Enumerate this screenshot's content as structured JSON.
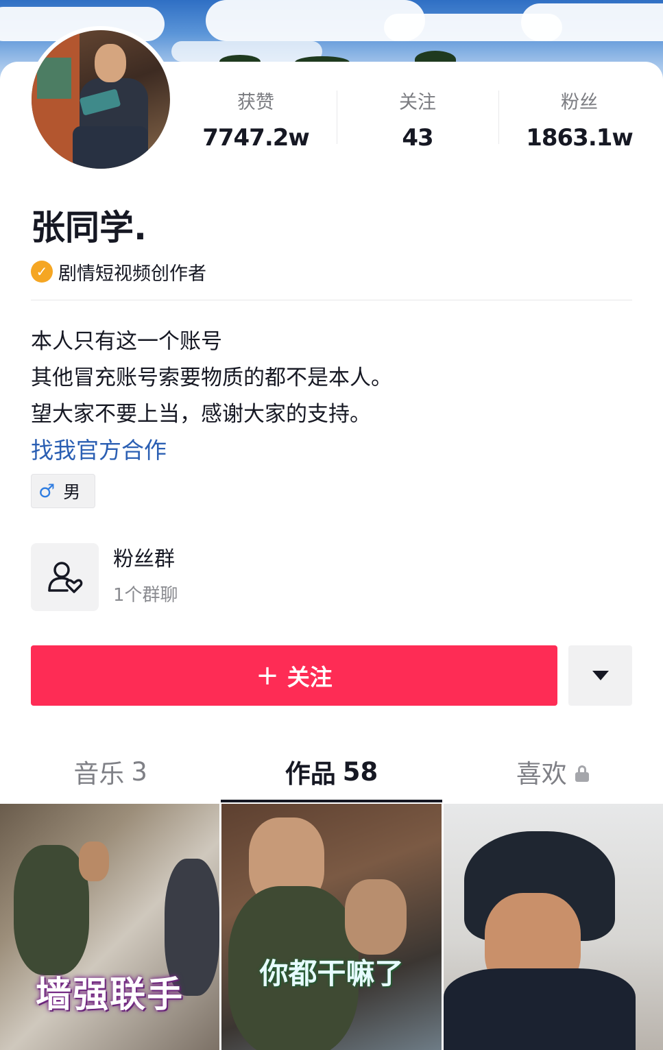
{
  "profile": {
    "name": "张同学.",
    "verification": "剧情短视频创作者",
    "gender": "男"
  },
  "stats": [
    {
      "label": "获赞",
      "value": "7747.2w"
    },
    {
      "label": "关注",
      "value": "43"
    },
    {
      "label": "粉丝",
      "value": "1863.1w"
    }
  ],
  "bio": {
    "lines": [
      "本人只有这一个账号",
      "其他冒充账号索要物质的都不是本人。",
      "望大家不要上当，感谢大家的支持。"
    ],
    "link": "找我官方合作"
  },
  "fan_group": {
    "title": "粉丝群",
    "subtitle": "1个群聊"
  },
  "actions": {
    "follow_plus": "+",
    "follow_label": "关注"
  },
  "tabs": [
    {
      "label": "音乐",
      "count": "3",
      "active": false
    },
    {
      "label": "作品",
      "count": "58",
      "active": true
    },
    {
      "label": "喜欢",
      "count": "",
      "active": false,
      "locked": true
    }
  ],
  "videos": [
    {
      "caption": "墙强联手"
    },
    {
      "caption": "你都干嘛了"
    },
    {
      "caption": ""
    }
  ],
  "colors": {
    "accent": "#fe2c55",
    "link": "#2b5fb3",
    "verify_badge": "#f5a623",
    "gender_icon": "#2f7de1"
  },
  "icons": {
    "verify": "check-badge-icon",
    "gender": "male-icon",
    "fan_group": "group-heart-icon",
    "more": "caret-down-icon",
    "lock": "lock-icon"
  }
}
